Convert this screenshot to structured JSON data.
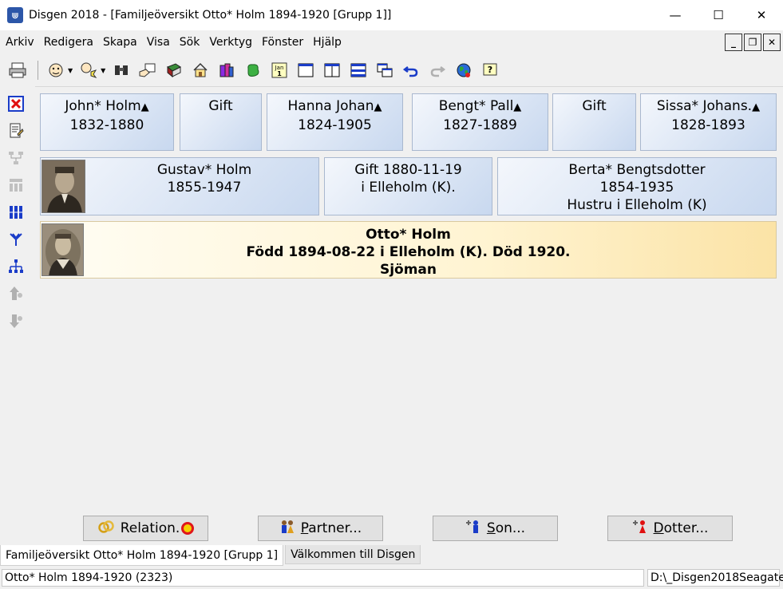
{
  "window": {
    "title": "Disgen 2018 - [Familjeöversikt Otto* Holm 1894-1920 [Grupp 1]]",
    "app_icon": "disgen-logo",
    "minimize": "—",
    "maximize": "☐",
    "close": "✕"
  },
  "menu": {
    "items": [
      "Arkiv",
      "Redigera",
      "Skapa",
      "Visa",
      "Sök",
      "Verktyg",
      "Fönster",
      "Hjälp"
    ],
    "mdi_minimize": "_",
    "mdi_restore": "❐",
    "mdi_close": "✕"
  },
  "toolbar": {
    "icons": [
      "printer-icon",
      "person-icon",
      "person-search-icon",
      "binoculars-icon",
      "hand-note-icon",
      "book-icon",
      "house-icon",
      "books-icon",
      "green-blob-icon",
      "calendar-icon",
      "window-icon",
      "split-window-icon",
      "list-window-icon",
      "cascade-window-icon",
      "undo-icon",
      "redo-icon",
      "globe-icon",
      "help-icon"
    ],
    "calendar_label": "Jan 1",
    "help_label": "?"
  },
  "left_toolbar": {
    "icons": [
      "close-red-x-icon",
      "edit-document-icon",
      "tree-icon",
      "group-icon",
      "columns-icon",
      "descendants-icon",
      "hierarchy-icon",
      "up-person-icon",
      "down-person-icon"
    ]
  },
  "family": {
    "grandparents": [
      {
        "name": "John* Holm",
        "years": "1832-1880",
        "marker": "▲"
      },
      {
        "relation": "Gift"
      },
      {
        "name": "Hanna Johan",
        "years": "1824-1905",
        "marker": "▲"
      },
      {
        "name": "Bengt* Pall",
        "years": "1827-1889",
        "marker": "▲"
      },
      {
        "relation": "Gift"
      },
      {
        "name": "Sissa* Johans.",
        "years": "1828-1893",
        "marker": "▲"
      }
    ],
    "father": {
      "name": "Gustav* Holm",
      "years": "1855-1947"
    },
    "marriage": {
      "line1": "Gift 1880-11-19",
      "line2": "i  Elleholm (K)."
    },
    "mother": {
      "name": "Berta* Bengtsdotter",
      "years": "1854-1935",
      "role": "Hustru  i Elleholm (K)"
    },
    "main": {
      "name": "Otto* Holm",
      "details": "Född 1894-08-22 i Elleholm (K). Död 1920.",
      "occupation": "Sjöman"
    }
  },
  "actions": {
    "relation": "Relation.",
    "partner_prefix": "",
    "partner_underline": "P",
    "partner_rest": "artner...",
    "son_underline": "S",
    "son_rest": "on...",
    "daughter_underline": "D",
    "daughter_rest": "otter..."
  },
  "tabs": [
    {
      "label": "Familjeöversikt Otto* Holm 1894-1920 [Grupp 1]",
      "active": true
    },
    {
      "label": "Välkommen till Disgen",
      "active": false
    }
  ],
  "status": {
    "left": "Otto* Holm 1894-1920 (2323)",
    "right": "D:\\_Disgen2018Seagate"
  },
  "colors": {
    "box_light": "#f4f7fc",
    "box_dark": "#c8d8ef",
    "main_light": "#fffdf4",
    "main_dark": "#fbe3a6"
  }
}
